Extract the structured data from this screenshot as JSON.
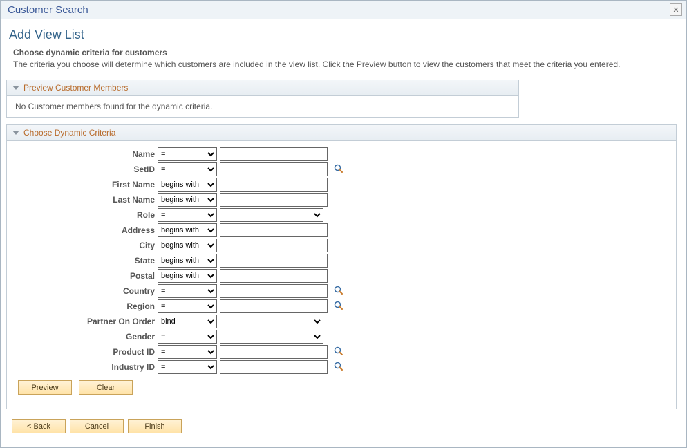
{
  "window": {
    "title": "Customer Search"
  },
  "page": {
    "title": "Add View List",
    "instructions_heading": "Choose dynamic criteria for customers",
    "instructions_body": "The criteria you choose will determine which customers are included in the view list. Click the Preview button to view the customers that meet the criteria you entered."
  },
  "sections": {
    "preview": {
      "title": "Preview Customer Members",
      "empty": "No Customer members found for the dynamic criteria."
    },
    "criteria": {
      "title": "Choose Dynamic Criteria"
    }
  },
  "criteria": [
    {
      "label": "Name",
      "op": "=",
      "input": "text",
      "value": "",
      "lookup": false
    },
    {
      "label": "SetID",
      "op": "=",
      "input": "text",
      "value": "",
      "lookup": true
    },
    {
      "label": "First Name",
      "op": "begins with",
      "input": "text",
      "value": "",
      "lookup": false
    },
    {
      "label": "Last Name",
      "op": "begins with",
      "input": "text",
      "value": "",
      "lookup": false
    },
    {
      "label": "Role",
      "op": "=",
      "input": "select",
      "value": "",
      "lookup": false
    },
    {
      "label": "Address",
      "op": "begins with",
      "input": "text",
      "value": "",
      "lookup": false
    },
    {
      "label": "City",
      "op": "begins with",
      "input": "text",
      "value": "",
      "lookup": false
    },
    {
      "label": "State",
      "op": "begins with",
      "input": "text",
      "value": "",
      "lookup": false
    },
    {
      "label": "Postal",
      "op": "begins with",
      "input": "text",
      "value": "",
      "lookup": false
    },
    {
      "label": "Country",
      "op": "=",
      "input": "text",
      "value": "",
      "lookup": true
    },
    {
      "label": "Region",
      "op": "=",
      "input": "text",
      "value": "",
      "lookup": true
    },
    {
      "label": "Partner On Order",
      "op": "bind",
      "input": "select",
      "value": "",
      "lookup": false
    },
    {
      "label": "Gender",
      "op": "=",
      "input": "select",
      "value": "",
      "lookup": false
    },
    {
      "label": "Product ID",
      "op": "=",
      "input": "text",
      "value": "",
      "lookup": true
    },
    {
      "label": "Industry ID",
      "op": "=",
      "input": "text",
      "value": "",
      "lookup": true
    }
  ],
  "buttons": {
    "preview": "Preview",
    "clear": "Clear",
    "back": "< Back",
    "cancel": "Cancel",
    "finish": "Finish"
  }
}
